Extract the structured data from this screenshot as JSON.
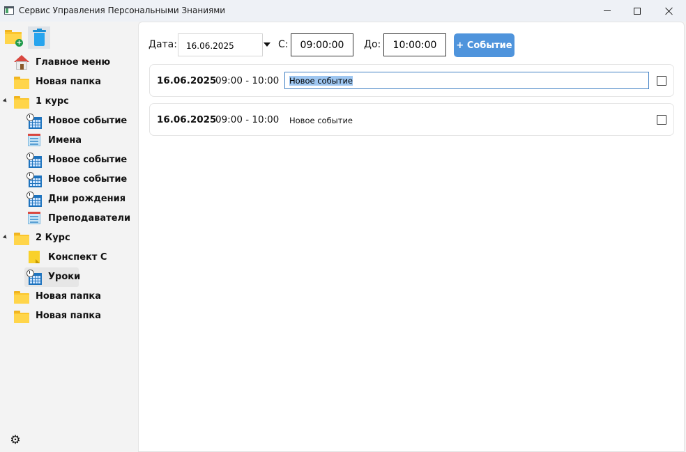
{
  "window": {
    "title": "Сервис Управления Персональными Знаниями"
  },
  "sidebar": {
    "toolbar": [
      {
        "name": "new-folder-icon"
      },
      {
        "name": "trash-icon"
      }
    ],
    "tree": [
      {
        "label": "Главное меню",
        "icon": "home-icon",
        "level": 0
      },
      {
        "label": "Новая папка",
        "icon": "folder-icon",
        "level": 0
      },
      {
        "label": "1 курс",
        "icon": "folder-icon",
        "level": 0,
        "expanded": true
      },
      {
        "label": "Новое событие",
        "icon": "calendar-icon",
        "level": 1
      },
      {
        "label": "Имена",
        "icon": "list-icon",
        "level": 1
      },
      {
        "label": "Новое событие",
        "icon": "calendar-icon",
        "level": 1
      },
      {
        "label": "Новое событие",
        "icon": "calendar-icon",
        "level": 1
      },
      {
        "label": "Дни рождения",
        "icon": "calendar-icon",
        "level": 1
      },
      {
        "label": "Преподаватели",
        "icon": "list-icon",
        "level": 1
      },
      {
        "label": "2 Курс",
        "icon": "folder-icon",
        "level": 0,
        "expanded": true
      },
      {
        "label": "Конспект С",
        "icon": "note-icon",
        "level": 1
      },
      {
        "label": "Уроки",
        "icon": "calendar-icon",
        "level": 1,
        "selected": true
      },
      {
        "label": "Новая папка",
        "icon": "folder-icon",
        "level": 0
      },
      {
        "label": "Новая папка",
        "icon": "folder-icon",
        "level": 0
      }
    ],
    "settings_icon": "gear-icon"
  },
  "form": {
    "date_label": "Дата:",
    "date_value": "16.06.2025",
    "from_label": "С:",
    "from_value": "09:00:00",
    "to_label": "До:",
    "to_value": "10:00:00",
    "add_button": "+ Событие"
  },
  "events": [
    {
      "date": "16.06.2025",
      "time": "09:00 - 10:00",
      "title": "Новое событие",
      "editing": true,
      "checked": false
    },
    {
      "date": "16.06.2025",
      "time": "09:00 - 10:00",
      "title": "Новое событие",
      "editing": false,
      "checked": false
    }
  ],
  "colors": {
    "accent": "#4f94dc",
    "folder": "#fbc52d",
    "calendar": "#1e73be",
    "selection": "#9ec6f0"
  }
}
